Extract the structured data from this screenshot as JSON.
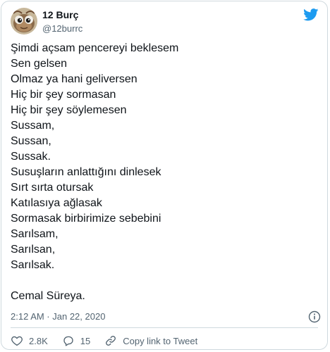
{
  "author": {
    "display_name": "12 Burç",
    "handle": "@12burrc"
  },
  "tweet": {
    "lines": [
      "Şimdi açsam pencereyi beklesem",
      "Sen gelsen",
      "Olmaz ya hani geliversen",
      "Hiç bir şey sormasan",
      "Hiç bir şey söylemesen",
      "Sussam,",
      "Sussan,",
      "Sussak.",
      "Susuşların anlattığını dinlesek",
      "Sırt sırta otursak",
      "Katılasıya ağlasak",
      "Sormasak birbirimize sebebini",
      "Sarılsam,",
      "Sarılsan,",
      "Sarılsak."
    ],
    "signature": "Cemal Süreya.",
    "timestamp": "2:12 AM · Jan 22, 2020"
  },
  "actions": {
    "like_count": "2.8K",
    "reply_count": "15",
    "copy_link_label": "Copy link to Tweet"
  },
  "icons": {
    "brand": "twitter-bird-icon",
    "info": "info-icon",
    "like": "heart-icon",
    "reply": "reply-bubble-icon",
    "link": "link-icon"
  },
  "colors": {
    "brand_blue": "#1d9bf0",
    "text": "#0f1419",
    "secondary_text": "#536471",
    "border": "#cfd9de"
  }
}
